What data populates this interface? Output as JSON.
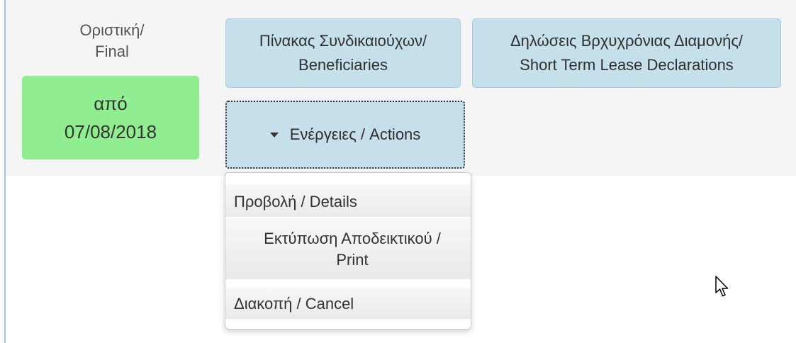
{
  "status": {
    "label_line1": "Οριστική/",
    "label_line2": "Final",
    "badge_line1": "από",
    "badge_line2": "07/08/2018",
    "badge_color": "#90ee90"
  },
  "buttons": {
    "beneficiaries": {
      "line1": "Πίνακας Συνδικαιούχων/",
      "line2": "Beneficiaries"
    },
    "declarations": {
      "line1": "Δηλώσεις Βρχυχρόνιας Διαμονής/",
      "line2": "Short Term Lease Declarations"
    },
    "actions": {
      "label": "Ενέργειες /  Actions",
      "icon": "caret-down-icon"
    }
  },
  "dropdown": {
    "details": "Προβολή / Details",
    "print_line1": "Εκτύπωση Αποδεικτικού /",
    "print_line2": "Print",
    "cancel": "Διακοπή /  Cancel"
  },
  "colors": {
    "button_bg": "#c5e0ea",
    "row_bg": "#f5f5f5"
  }
}
